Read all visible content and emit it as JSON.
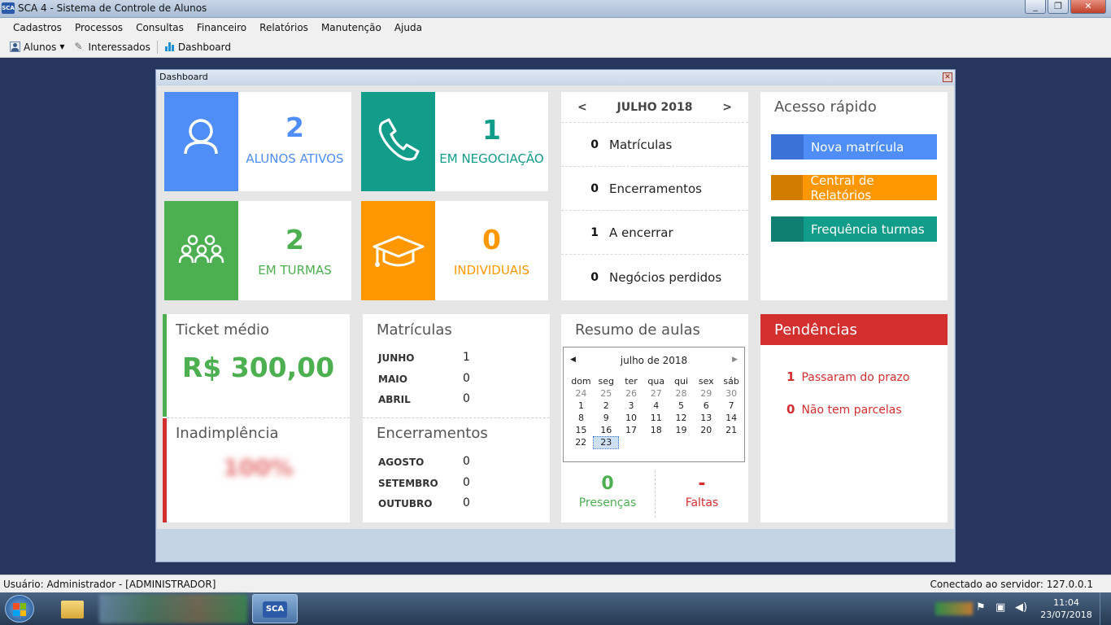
{
  "window": {
    "title": "SCA 4 - Sistema de Controle de Alunos",
    "app_icon": "SCA"
  },
  "menu": [
    "Cadastros",
    "Processos",
    "Consultas",
    "Financeiro",
    "Relatórios",
    "Manutenção",
    "Ajuda"
  ],
  "toolbar": {
    "alunos": "Alunos",
    "interessados": "Interessados",
    "dashboard": "Dashboard"
  },
  "dashboard": {
    "title": "Dashboard",
    "tiles": [
      {
        "value": "2",
        "label": "ALUNOS ATIVOS",
        "color": "#4f8ef7",
        "icon": "user-icon"
      },
      {
        "value": "1",
        "label": "EM NEGOCIAÇÃO",
        "color": "#129c8a",
        "icon": "phone-icon"
      },
      {
        "value": "2",
        "label": "EM TURMAS",
        "color": "#4caf50",
        "icon": "group-icon"
      },
      {
        "value": "0",
        "label": "INDIVIDUAIS",
        "color": "#ff9800",
        "icon": "graduation-cap-icon"
      }
    ],
    "calendar_summary": {
      "prev": "<",
      "next": ">",
      "month": "JULHO 2018",
      "rows": [
        {
          "n": "0",
          "label": "Matrículas"
        },
        {
          "n": "0",
          "label": "Encerramentos"
        },
        {
          "n": "1",
          "label": "A encerrar"
        },
        {
          "n": "0",
          "label": "Negócios perdidos"
        }
      ]
    },
    "quick_access": {
      "title": "Acesso rápido",
      "buttons": [
        {
          "label": "Nova matrícula",
          "color": "#4f8ef7",
          "dark": "#3a72d8"
        },
        {
          "label": "Central de Relatórios",
          "color": "#ff9800",
          "dark": "#d17d00"
        },
        {
          "label": "Frequência turmas",
          "color": "#129c8a",
          "dark": "#0e7f70"
        }
      ]
    },
    "ticket": {
      "title": "Ticket médio",
      "value": "R$ 300,00"
    },
    "inadimplencia": {
      "title": "Inadimplência",
      "value": "100%"
    },
    "matriculas": {
      "title": "Matrículas",
      "rows": [
        {
          "m": "JUNHO",
          "v": "1"
        },
        {
          "m": "MAIO",
          "v": "0"
        },
        {
          "m": "ABRIL",
          "v": "0"
        }
      ]
    },
    "encerramentos": {
      "title": "Encerramentos",
      "rows": [
        {
          "m": "AGOSTO",
          "v": "0"
        },
        {
          "m": "SETEMBRO",
          "v": "0"
        },
        {
          "m": "OUTUBRO",
          "v": "0"
        }
      ]
    },
    "resumo": {
      "title": "Resumo de aulas",
      "cal_title": "julho de 2018",
      "days": [
        "dom",
        "seg",
        "ter",
        "qua",
        "qui",
        "sex",
        "sáb"
      ],
      "weeks": [
        [
          "24",
          "25",
          "26",
          "27",
          "28",
          "29",
          "30"
        ],
        [
          "1",
          "2",
          "3",
          "4",
          "5",
          "6",
          "7"
        ],
        [
          "8",
          "9",
          "10",
          "11",
          "12",
          "13",
          "14"
        ],
        [
          "15",
          "16",
          "17",
          "18",
          "19",
          "20",
          "21"
        ],
        [
          "22",
          "23",
          "",
          "",
          "",
          "",
          ""
        ]
      ],
      "today": "23",
      "presencas_value": "0",
      "presencas_label": "Presenças",
      "faltas_value": "-",
      "faltas_label": "Faltas"
    },
    "pendencias": {
      "title": "Pendências",
      "items": [
        {
          "n": "1",
          "label": "Passaram do prazo"
        },
        {
          "n": "0",
          "label": "Não tem parcelas"
        }
      ]
    }
  },
  "status": {
    "user": "Usuário: Administrador - [ADMINISTRADOR]",
    "server": "Conectado ao servidor: 127.0.0.1"
  },
  "taskbar": {
    "time": "11:04",
    "date": "23/07/2018",
    "app": "SCA"
  }
}
